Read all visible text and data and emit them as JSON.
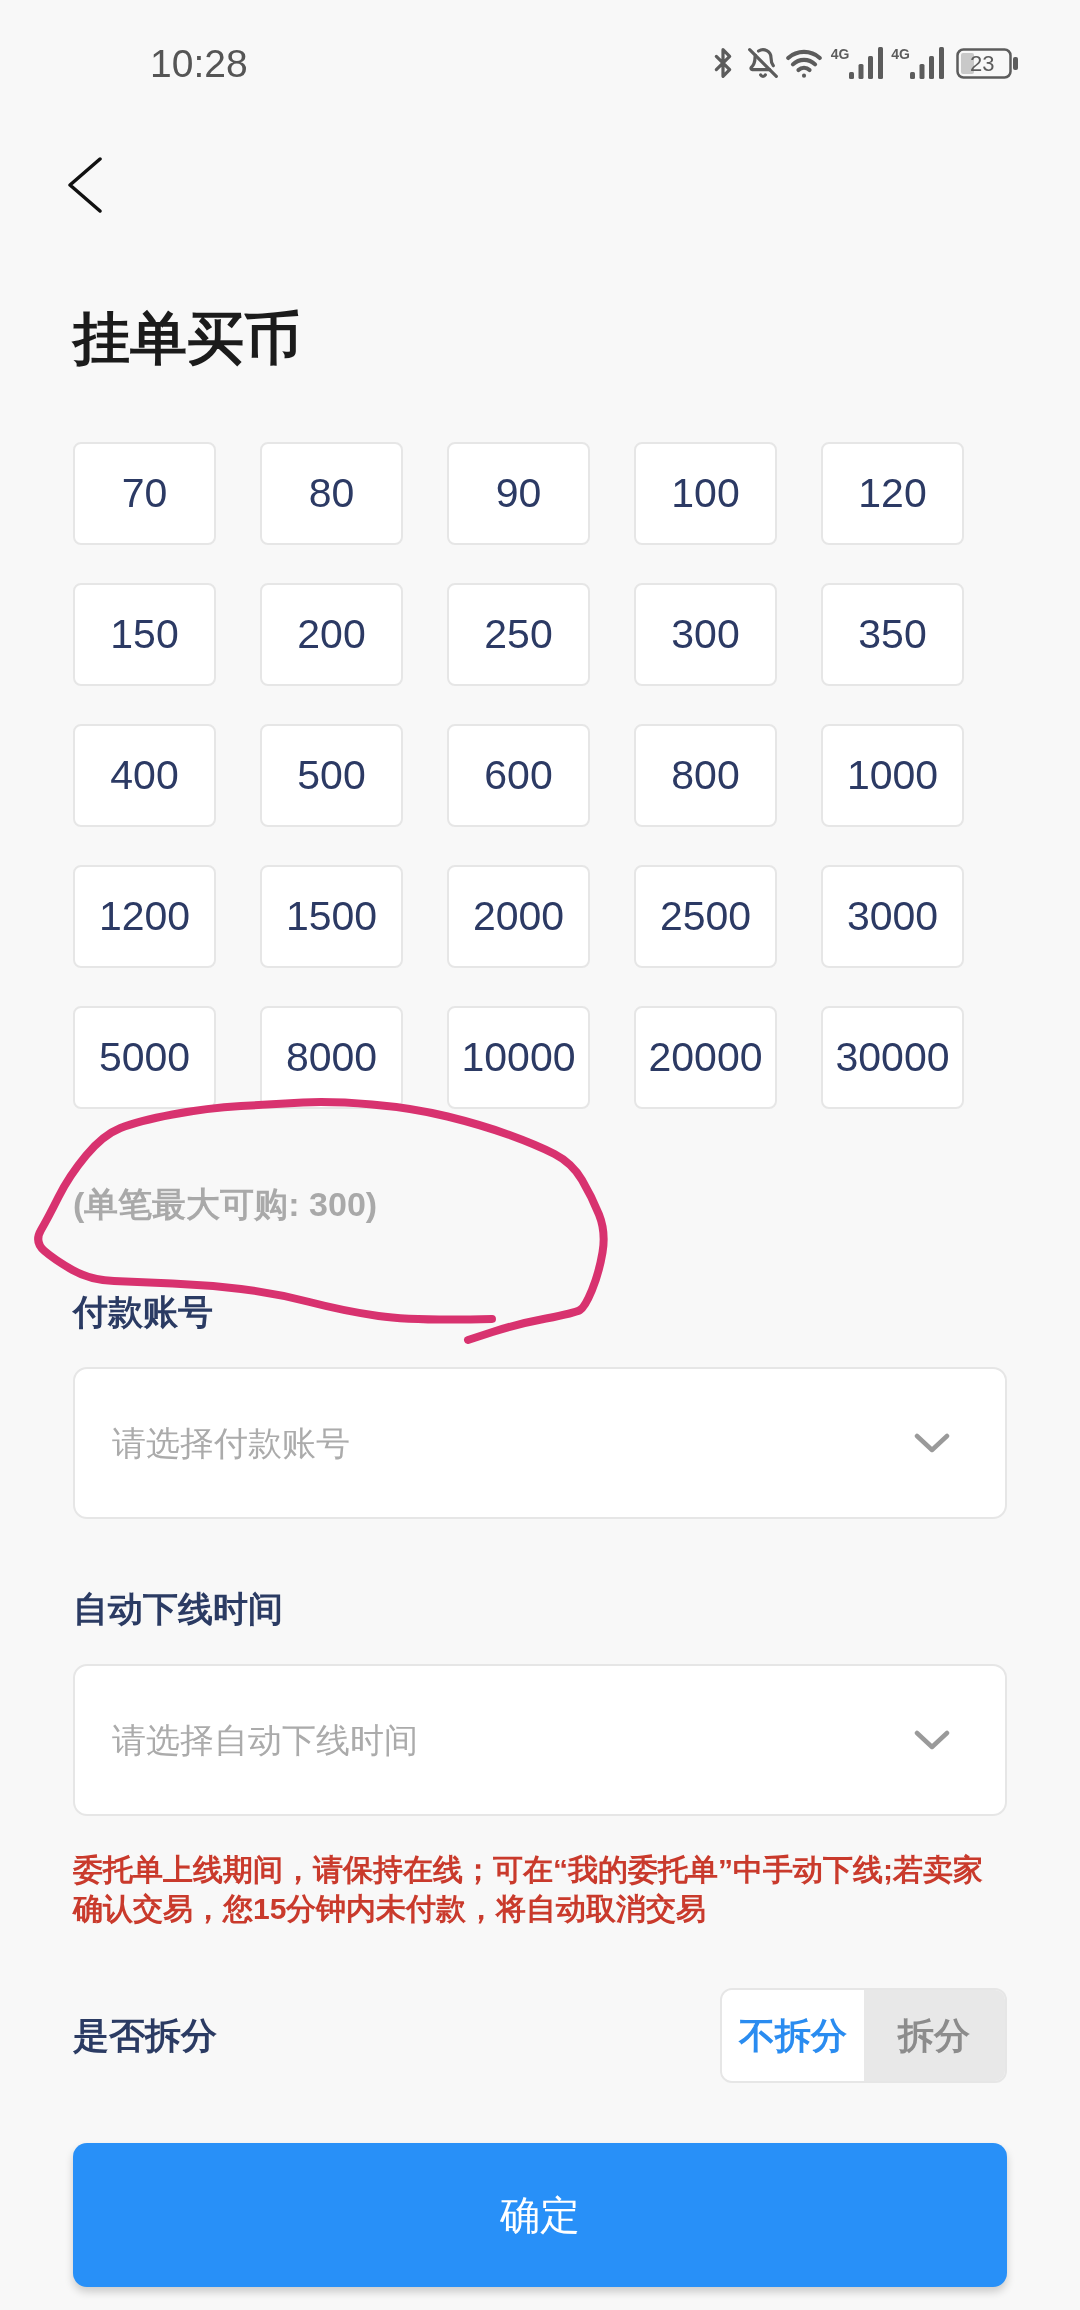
{
  "status_bar": {
    "time": "10:28",
    "networks": [
      "4G",
      "4G"
    ],
    "battery": "23"
  },
  "header": {
    "title": "挂单买币"
  },
  "amounts": [
    {
      "label": "70",
      "selected": false
    },
    {
      "label": "80",
      "selected": false
    },
    {
      "label": "90",
      "selected": false
    },
    {
      "label": "100",
      "selected": false
    },
    {
      "label": "120",
      "selected": false
    },
    {
      "label": "150",
      "selected": false
    },
    {
      "label": "200",
      "selected": false
    },
    {
      "label": "250",
      "selected": false
    },
    {
      "label": "300",
      "selected": false
    },
    {
      "label": "350",
      "selected": false
    },
    {
      "label": "400",
      "selected": false
    },
    {
      "label": "500",
      "selected": false
    },
    {
      "label": "600",
      "selected": false
    },
    {
      "label": "800",
      "selected": false
    },
    {
      "label": "1000",
      "selected": false
    },
    {
      "label": "1200",
      "selected": false
    },
    {
      "label": "1500",
      "selected": false
    },
    {
      "label": "2000",
      "selected": false
    },
    {
      "label": "2500",
      "selected": false
    },
    {
      "label": "3000",
      "selected": false
    },
    {
      "label": "5000",
      "selected": false
    },
    {
      "label": "8000",
      "selected": false
    },
    {
      "label": "10000",
      "selected": false
    },
    {
      "label": "20000",
      "selected": false
    },
    {
      "label": "30000",
      "selected": false
    }
  ],
  "max_purchase_note": "(单笔最大可购: 300)",
  "fields": [
    {
      "label": "付款账号",
      "placeholder": "请选择付款账号"
    },
    {
      "label": "自动下线时间",
      "placeholder": "请选择自动下线时间"
    }
  ],
  "warning": "委托单上线期间，请保持在线；可在“我的委托单”中手动下线;若卖家确认交易，您15分钟内未付款，将自动取消交易",
  "split": {
    "label": "是否拆分",
    "options": [
      {
        "label": "不拆分",
        "selected": true
      },
      {
        "label": "拆分",
        "selected": false
      }
    ]
  },
  "confirm_button": "确定"
}
